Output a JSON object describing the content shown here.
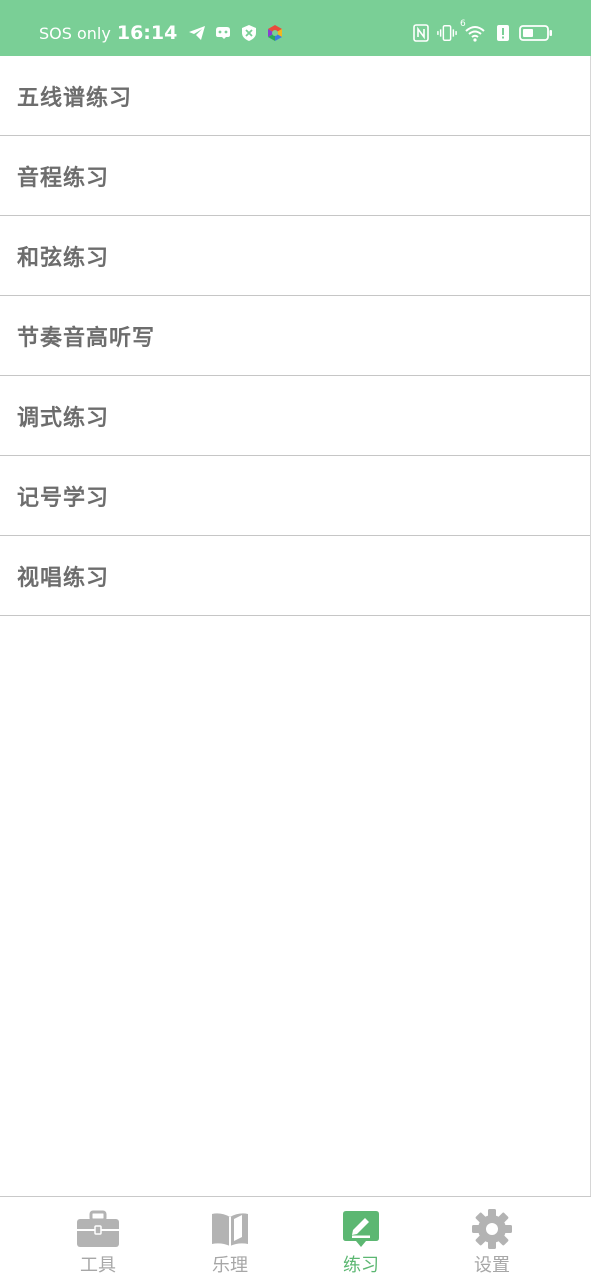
{
  "status_bar": {
    "carrier": "SOS only",
    "time": "16:14",
    "network": "6"
  },
  "menu": {
    "items": [
      {
        "label": "五线谱练习"
      },
      {
        "label": "音程练习"
      },
      {
        "label": "和弦练习"
      },
      {
        "label": "节奏音高听写"
      },
      {
        "label": "调式练习"
      },
      {
        "label": "记号学习"
      },
      {
        "label": "视唱练习"
      }
    ]
  },
  "tab_bar": {
    "tabs": [
      {
        "label": "工具",
        "icon": "toolbox-icon",
        "active": false
      },
      {
        "label": "乐理",
        "icon": "book-icon",
        "active": false
      },
      {
        "label": "练习",
        "icon": "pencil-chat-icon",
        "active": true
      },
      {
        "label": "设置",
        "icon": "gear-icon",
        "active": false
      }
    ]
  },
  "colors": {
    "status_bar_bg": "#7acf96",
    "accent": "#5cb772",
    "inactive": "#a7a7a7",
    "item_text": "#6d6d6d"
  }
}
